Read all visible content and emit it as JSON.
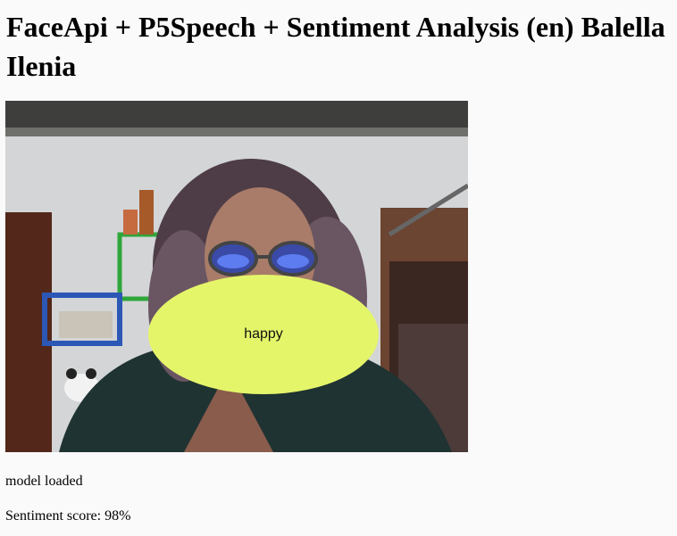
{
  "page": {
    "title": "FaceApi + P5Speech + Sentiment Analysis (en) Balella Ilenia"
  },
  "webcam": {
    "emotion_label": "happy",
    "bubble_color": "#e4f56a"
  },
  "status": {
    "model_text": "model loaded",
    "sentiment_text": "Sentiment score: 98%"
  }
}
